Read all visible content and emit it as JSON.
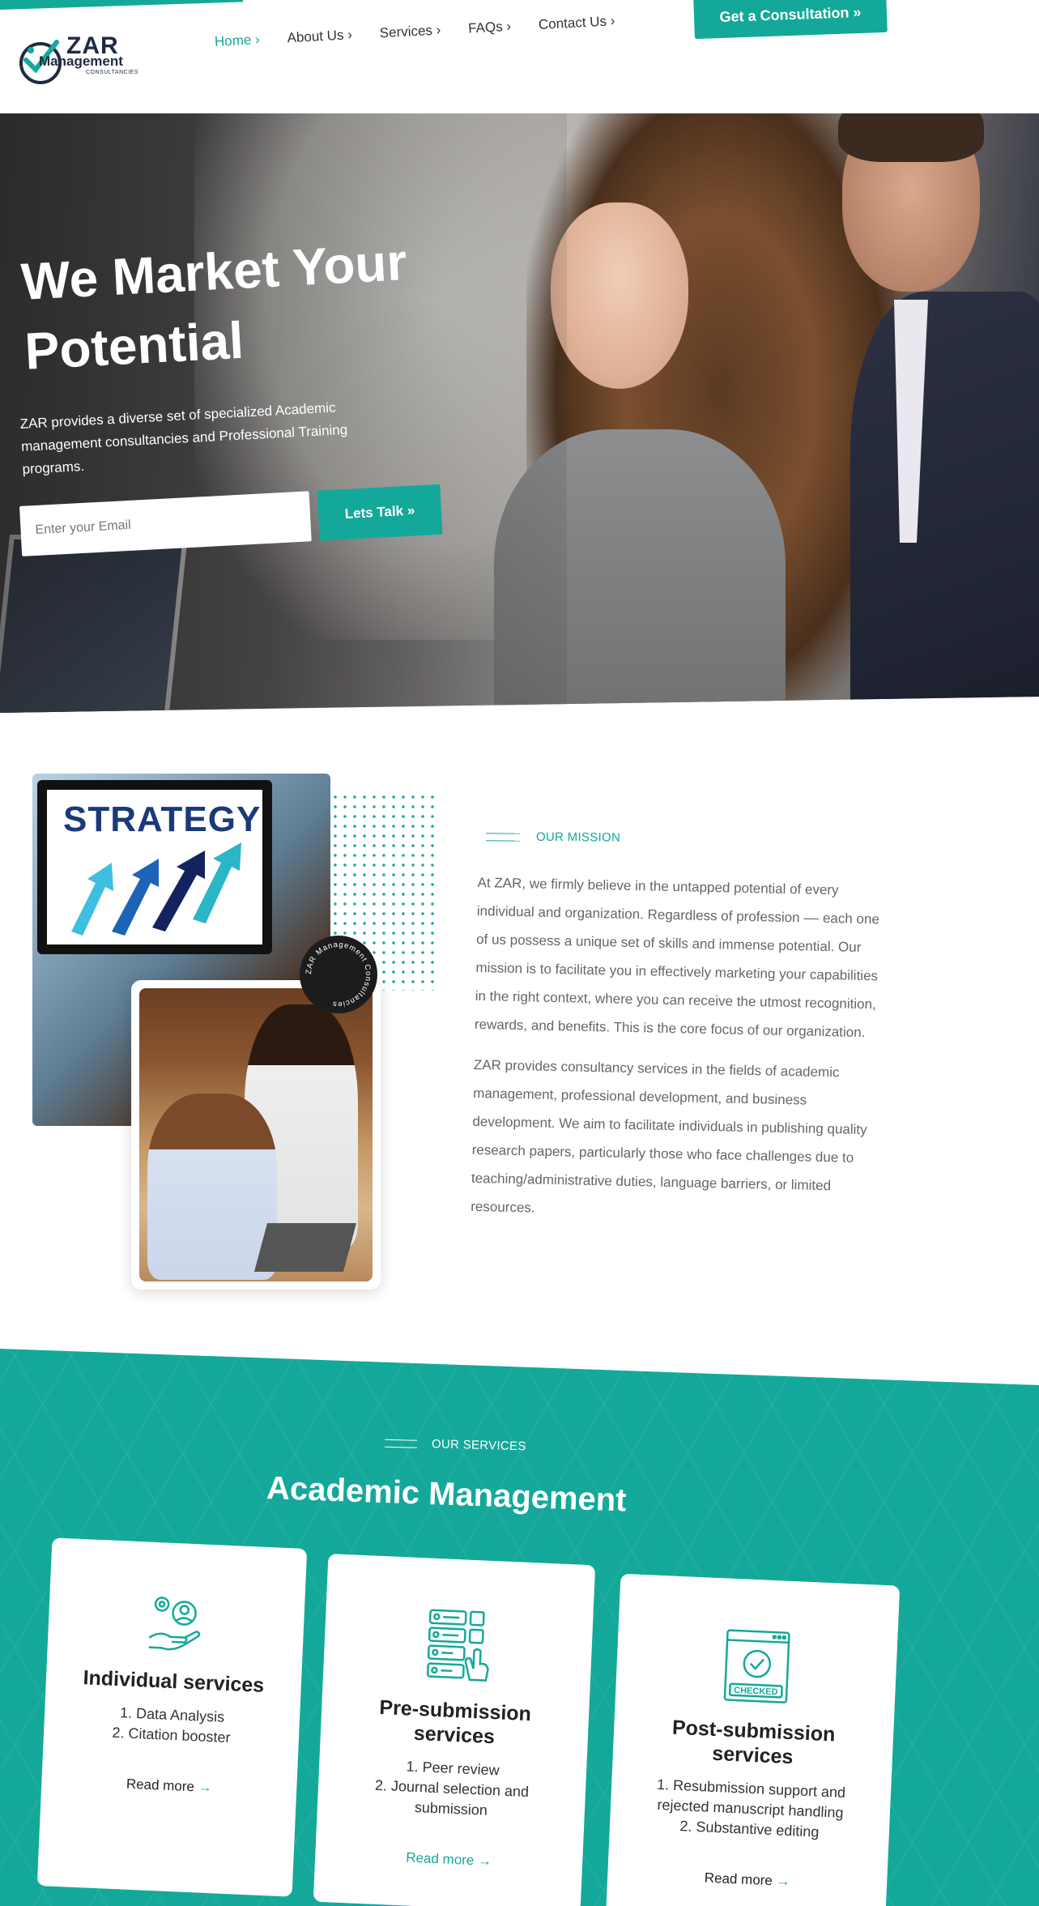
{
  "header": {
    "logo_text": "ZAR",
    "logo_sub": "Management",
    "logo_sub2": "CONSULTANCIES",
    "nav": [
      {
        "label": "Home"
      },
      {
        "label": "About Us"
      },
      {
        "label": "Services"
      },
      {
        "label": "FAQs"
      },
      {
        "label": "Contact Us"
      }
    ],
    "cta_label": "Get a Consultation »"
  },
  "hero": {
    "title": "We Market Your Potential",
    "subtitle": "ZAR provides a diverse set of specialized Academic management consultancies and Professional Training programs.",
    "email_placeholder": "Enter your Email",
    "button_label": "Lets Talk »"
  },
  "mission": {
    "tag": "OUR MISSION",
    "image_headline": "STRATEGY",
    "badge_text": "ZAR Management Consultancies",
    "paragraph_1": "At ZAR, we firmly believe in the untapped potential of every individual and organization. Regardless of profession –– each one of us possess a unique set of skills and immense potential. Our mission is to facilitate you in effectively marketing your capabilities in the right context, where you can receive the utmost recognition, rewards, and benefits. This is the core focus of our organization.",
    "paragraph_2": "ZAR provides consultancy services in the fields of academic management, professional development, and business development. We aim to facilitate individuals in publishing quality research papers, particularly those who face challenges due to teaching/administrative duties, language barriers, or limited resources."
  },
  "services": {
    "tag": "OUR SERVICES",
    "title": "Academic Management",
    "cards": [
      {
        "title": "Individual services",
        "items": [
          "1. Data Analysis",
          "2. Citation booster"
        ],
        "link": "Read more",
        "icon": "gear-hand-icon"
      },
      {
        "title": "Pre-submission services",
        "items": [
          "1. Peer review",
          "2. Journal selection and submission"
        ],
        "link": "Read more",
        "icon": "checklist-touch-icon"
      },
      {
        "title": "Post-submission services",
        "items": [
          "1. Resubmission support and rejected manuscript handling",
          "2. Substantive editing"
        ],
        "link": "Read more",
        "icon": "checked-window-icon"
      }
    ]
  },
  "colors": {
    "accent": "#14a89a",
    "dark": "#1f2a44"
  }
}
